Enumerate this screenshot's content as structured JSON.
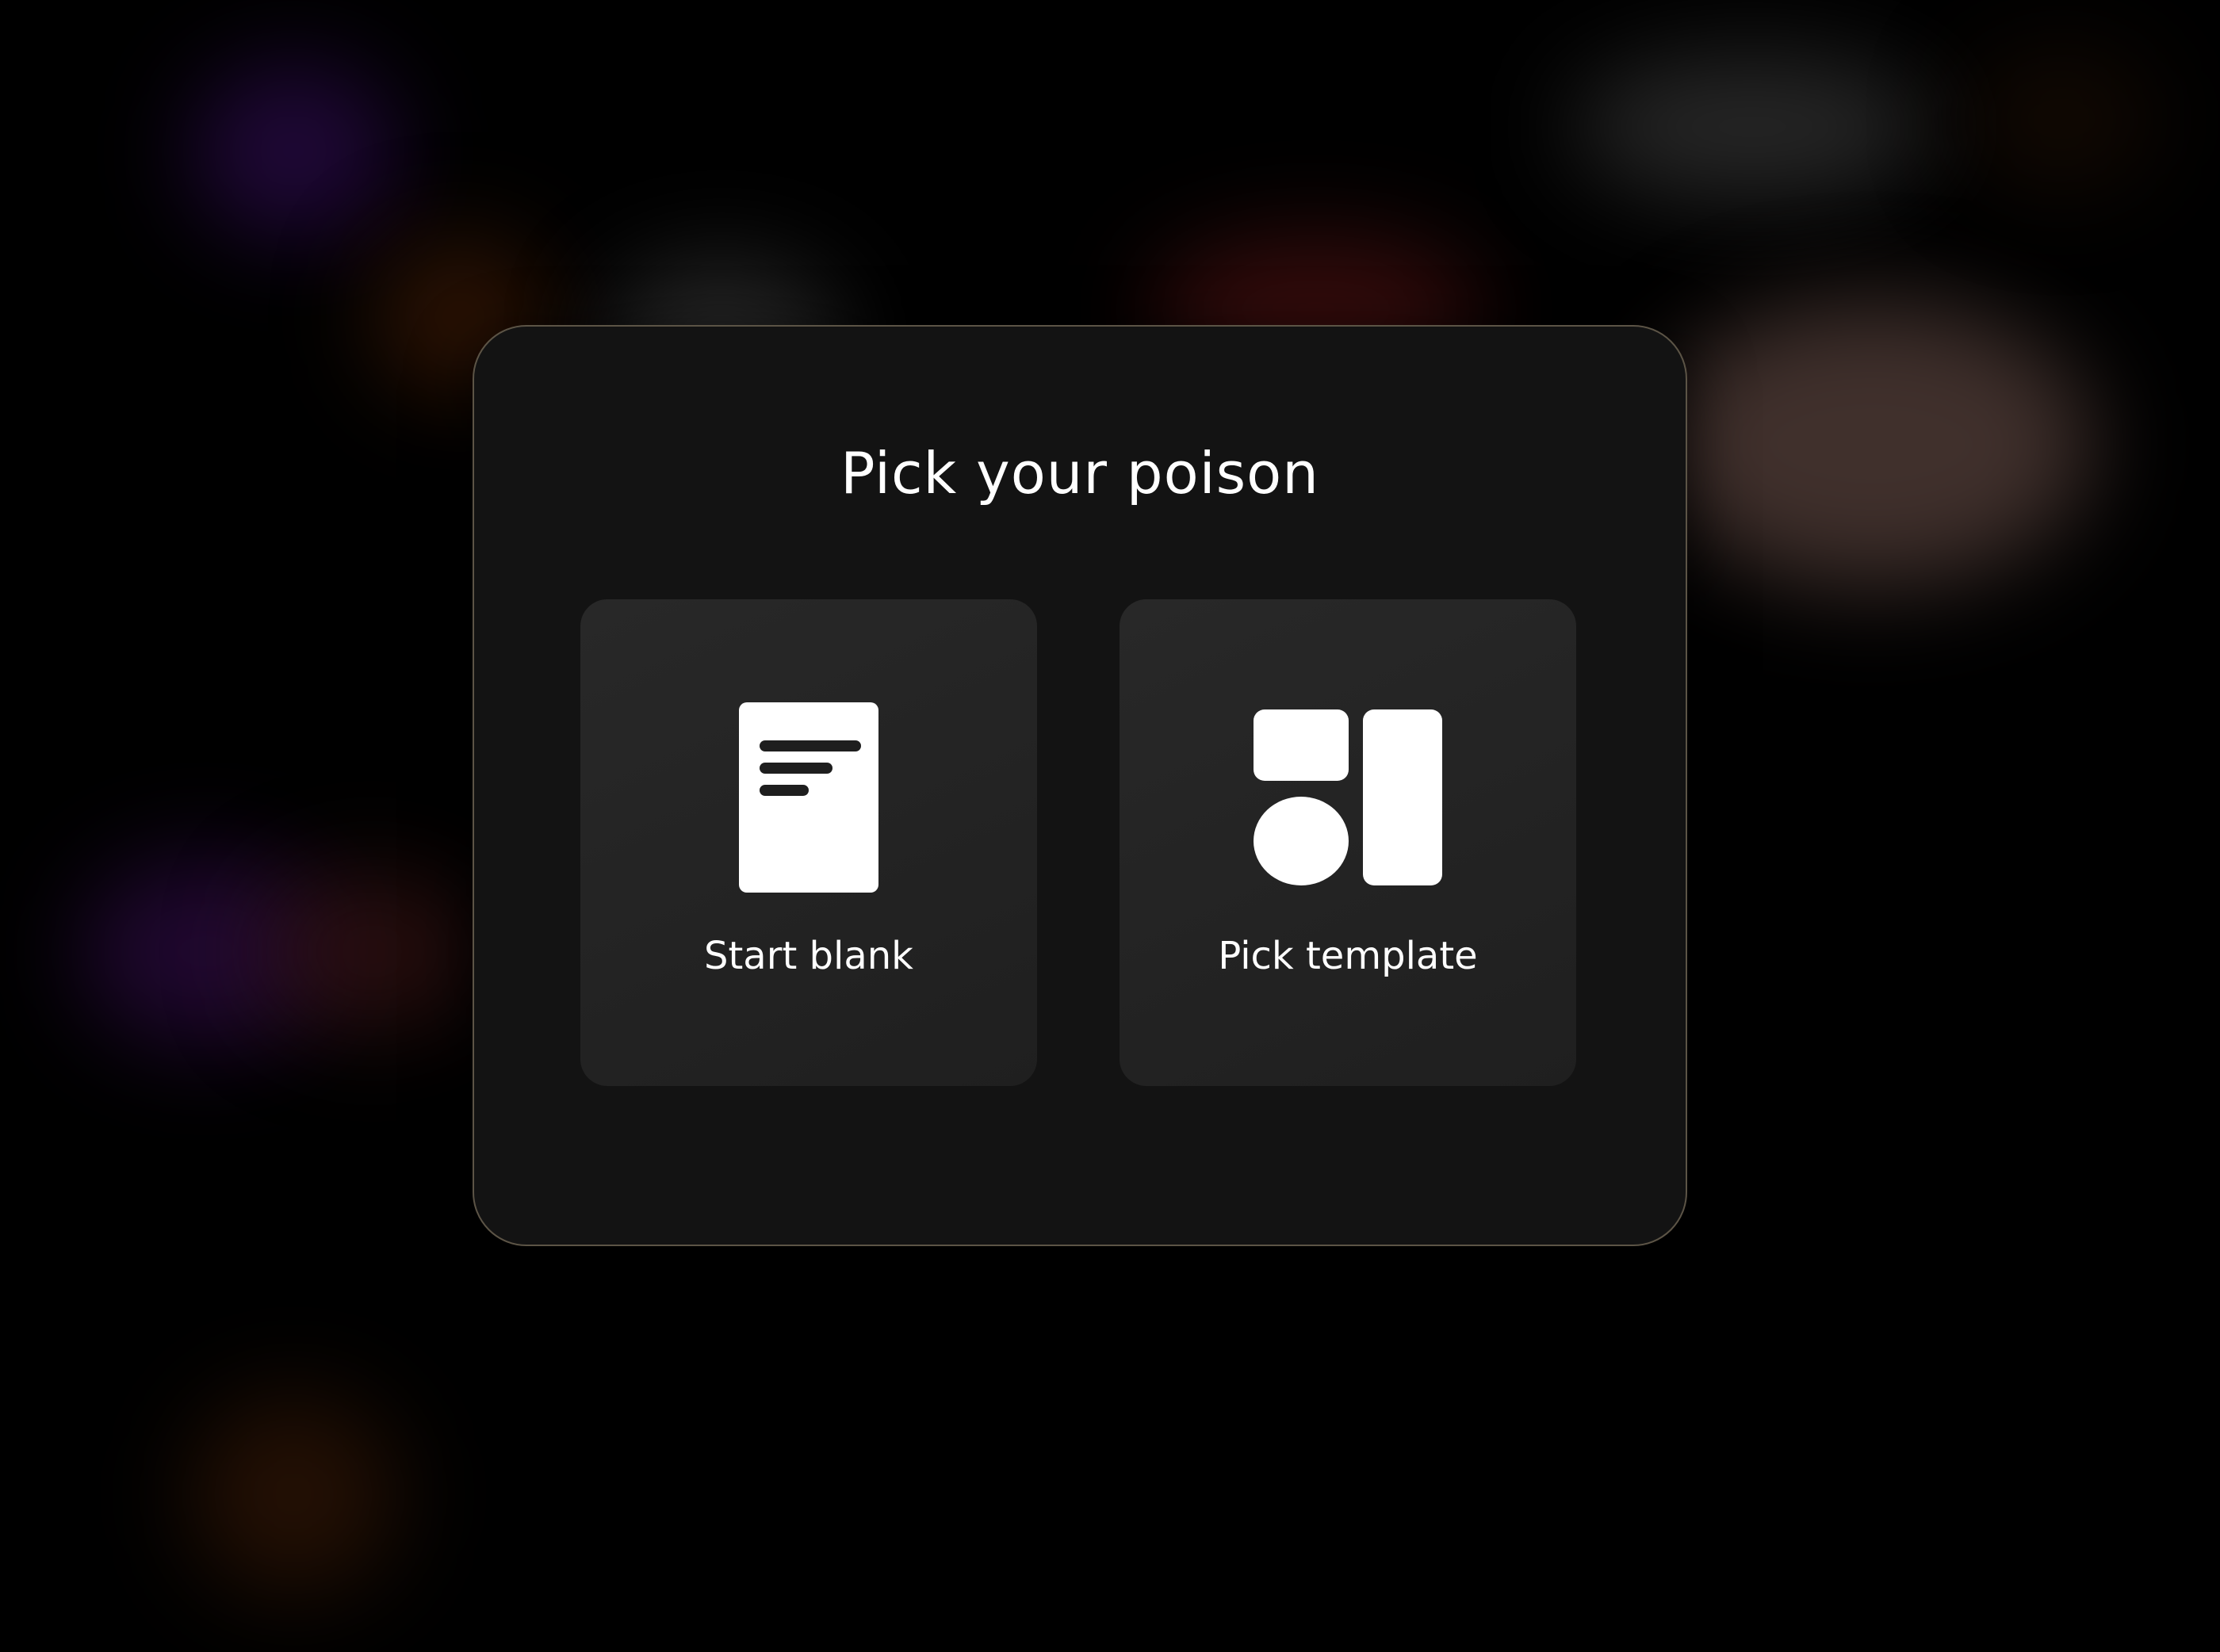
{
  "modal": {
    "title": "Pick your poison",
    "options": [
      {
        "label": "Start blank",
        "icon": "document-icon"
      },
      {
        "label": "Pick template",
        "icon": "template-grid-icon"
      }
    ]
  },
  "colors": {
    "background": "#000000",
    "modal_background": "#131313",
    "modal_border": "#5c5446",
    "card_background": "#222222",
    "icon_fill": "#ffffff",
    "text": "#ffffff"
  }
}
